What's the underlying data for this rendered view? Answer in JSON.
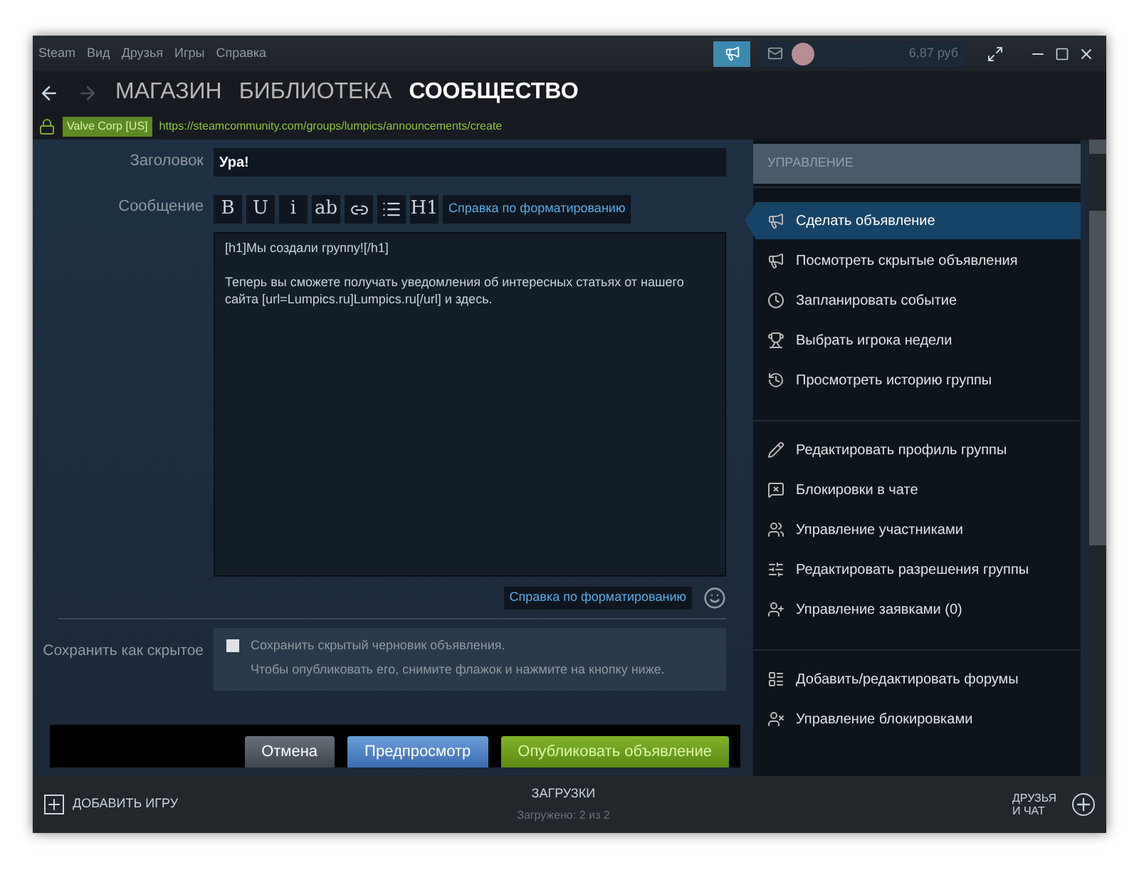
{
  "menu": [
    "Steam",
    "Вид",
    "Друзья",
    "Игры",
    "Справка"
  ],
  "account": {
    "balance": "6,87 руб"
  },
  "nav_tabs": [
    {
      "label": "МАГАЗИН",
      "selected": false
    },
    {
      "label": "БИБЛИОТЕКА",
      "selected": false
    },
    {
      "label": "СООБЩЕСТВО",
      "selected": true
    }
  ],
  "address_bar": {
    "certificate": "Valve Corp [US]",
    "url": "https://steamcommunity.com/groups/lumpics/announcements/create"
  },
  "form": {
    "title_label": "Заголовок",
    "title_value": "Ура!",
    "message_label": "Сообщение",
    "toolbar": [
      {
        "kind": "text",
        "label": "B"
      },
      {
        "kind": "text",
        "label": "U"
      },
      {
        "kind": "text",
        "label": "i"
      },
      {
        "kind": "text",
        "label": "ab"
      },
      {
        "kind": "link"
      },
      {
        "kind": "list"
      },
      {
        "kind": "text",
        "label": "H1"
      }
    ],
    "toolbar_help": "Справка по форматированию",
    "message_value": "[h1]Мы создали группу![/h1]\n\nТеперь вы сможете получать уведомления об интересных статьях от нашего сайта [url=Lumpics.ru]Lumpics.ru[/url] и здесь.",
    "bottom_help": "Справка по форматированию",
    "hidden_label": "Сохранить как скрытое",
    "hidden_checked": false,
    "hidden_text": "Сохранить скрытый черновик объявления.",
    "hidden_hint": "Чтобы опубликовать его, снимите флажок и нажмите на кнопку ниже.",
    "buttons": [
      {
        "kind": "cancel",
        "label": "Отмена"
      },
      {
        "kind": "preview",
        "label": "Предпросмотр"
      },
      {
        "kind": "publish",
        "label": "Опубликовать объявление"
      }
    ]
  },
  "sidebar": {
    "title": "УПРАВЛЕНИЕ",
    "groups": [
      {
        "items": [
          {
            "label": "Сделать объявление",
            "selected": true
          },
          {
            "label": "Посмотреть скрытые объявления",
            "selected": false
          },
          {
            "label": "Запланировать событие",
            "selected": false
          },
          {
            "label": "Выбрать игрока недели",
            "selected": false
          },
          {
            "label": "Просмотреть историю группы",
            "selected": false
          }
        ]
      },
      {
        "items": [
          {
            "label": "Редактировать профиль группы",
            "selected": false
          },
          {
            "label": "Блокировки в чате",
            "selected": false
          },
          {
            "label": "Управление участниками",
            "selected": false
          },
          {
            "label": "Редактировать разрешения группы",
            "selected": false
          },
          {
            "label": "Управление заявками (0)",
            "selected": false
          }
        ]
      },
      {
        "items": [
          {
            "label": "Добавить/редактировать форумы",
            "selected": false
          },
          {
            "label": "Управление блокировками",
            "selected": false
          }
        ]
      }
    ]
  },
  "status_bar": {
    "add_game": "ДОБАВИТЬ ИГРУ",
    "downloads_title": "ЗАГРУЗКИ",
    "downloads_status": "Загружено: 2 из 2",
    "friends": "ДРУЗЬЯ И ЧАТ"
  }
}
